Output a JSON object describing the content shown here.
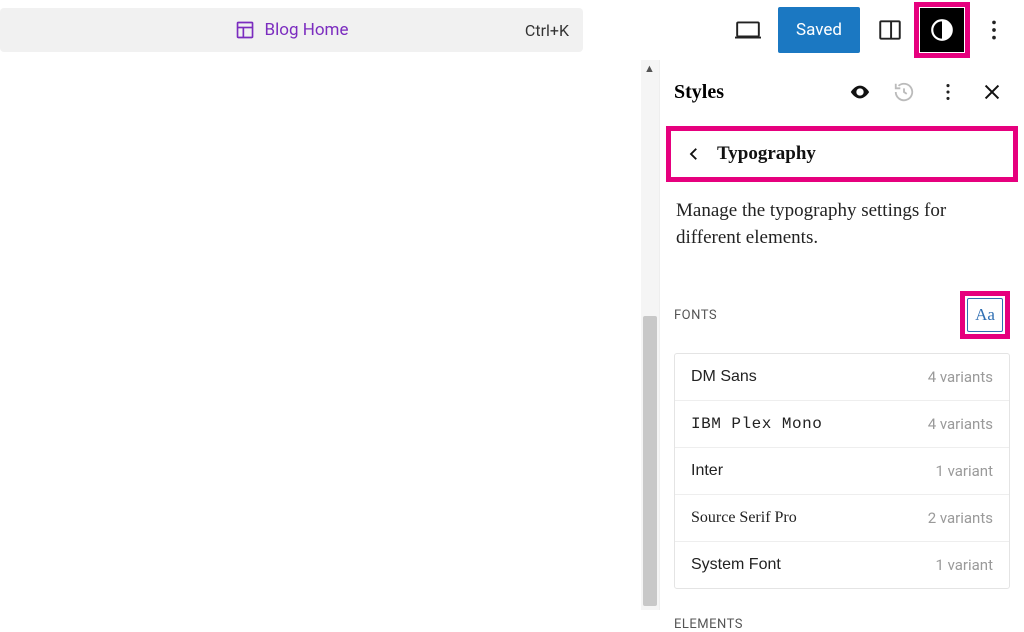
{
  "topbar": {
    "doc_title": "Blog Home",
    "shortcut": "Ctrl+K",
    "saved_label": "Saved"
  },
  "sidebar": {
    "title": "Styles",
    "nav_label": "Typography",
    "description": "Manage the typography settings for different elements.",
    "fonts_heading": "FONTS",
    "aa_label": "Aa",
    "fonts": [
      {
        "name": "DM Sans",
        "variants": "4 variants",
        "class": "f-dmsans"
      },
      {
        "name": "IBM Plex Mono",
        "variants": "4 variants",
        "class": "f-ibm"
      },
      {
        "name": "Inter",
        "variants": "1 variant",
        "class": "f-inter"
      },
      {
        "name": "Source Serif Pro",
        "variants": "2 variants",
        "class": "f-serif"
      },
      {
        "name": "System Font",
        "variants": "1 variant",
        "class": "f-system"
      }
    ],
    "elements_heading": "ELEMENTS"
  }
}
